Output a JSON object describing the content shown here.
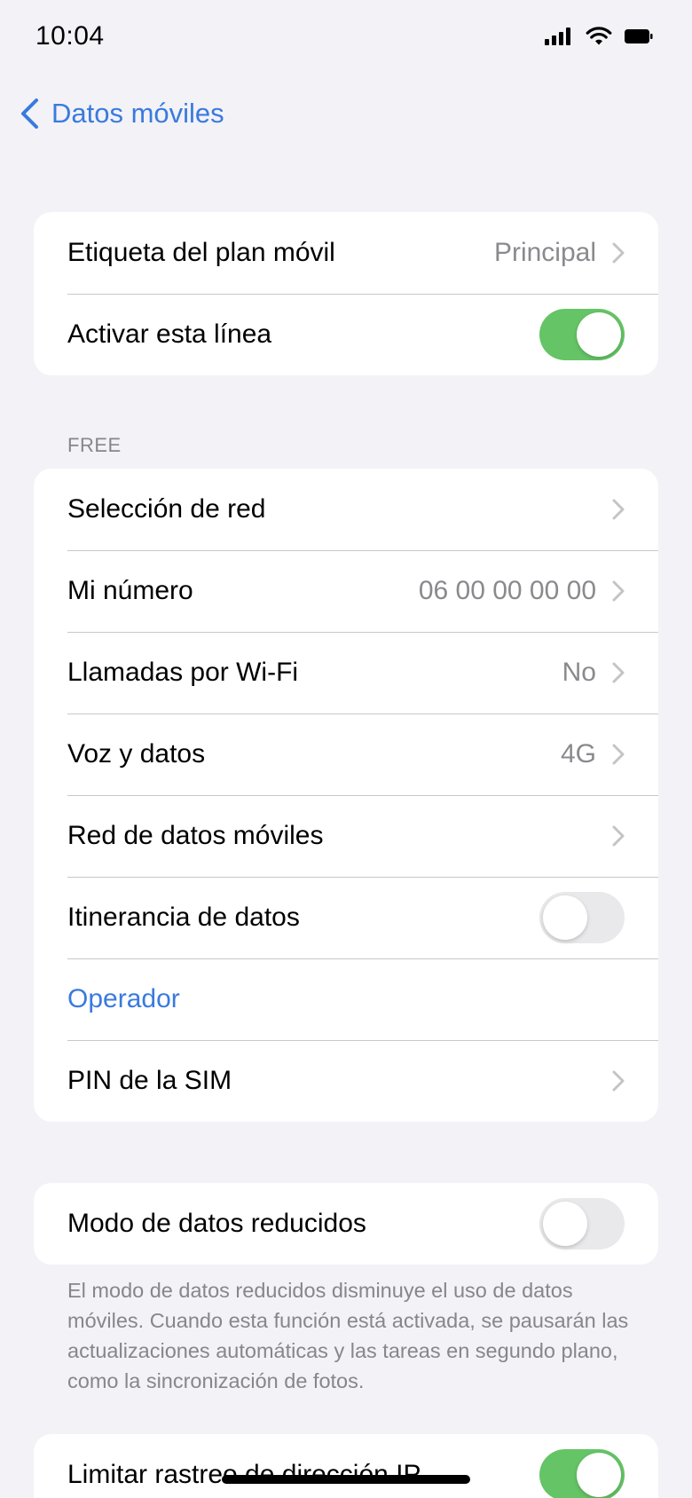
{
  "status_bar": {
    "time": "10:04",
    "icons": [
      "signal-icon",
      "wifi-icon",
      "battery-icon"
    ]
  },
  "nav": {
    "back_label": "Datos móviles",
    "back_icon": "chevron-left-icon"
  },
  "colors": {
    "accent": "#3a7ade",
    "toggle_on": "#65c466",
    "toggle_off": "#e9e9eb",
    "background": "#f2f2f7"
  },
  "group1": {
    "plan_label": {
      "label": "Etiqueta del plan móvil",
      "value": "Principal"
    },
    "activate_line": {
      "label": "Activar esta línea",
      "toggle": true
    }
  },
  "section_free": {
    "header": "FREE"
  },
  "group2": {
    "network_selection": {
      "label": "Selección de red"
    },
    "my_number": {
      "label": "Mi número",
      "value": "06 00 00 00 00"
    },
    "wifi_calling": {
      "label": "Llamadas por Wi-Fi",
      "value": "No"
    },
    "voice_data": {
      "label": "Voz y datos",
      "value": "4G"
    },
    "mobile_data_network": {
      "label": "Red de datos móviles"
    },
    "data_roaming": {
      "label": "Itinerancia de datos",
      "toggle": false
    },
    "operator": {
      "label": "Operador"
    },
    "sim_pin": {
      "label": "PIN de la SIM"
    }
  },
  "group3": {
    "low_data_mode": {
      "label": "Modo de datos reducidos",
      "toggle": false
    },
    "footnote": "El modo de datos reducidos disminuye el uso de datos móviles. Cuando esta función está activada, se pausarán las actualizaciones automáticas y las tareas en segundo plano, como la sincronización de fotos."
  },
  "group4": {
    "limit_ip_tracking": {
      "label": "Limitar rastreo de dirección IP",
      "toggle": true
    }
  }
}
